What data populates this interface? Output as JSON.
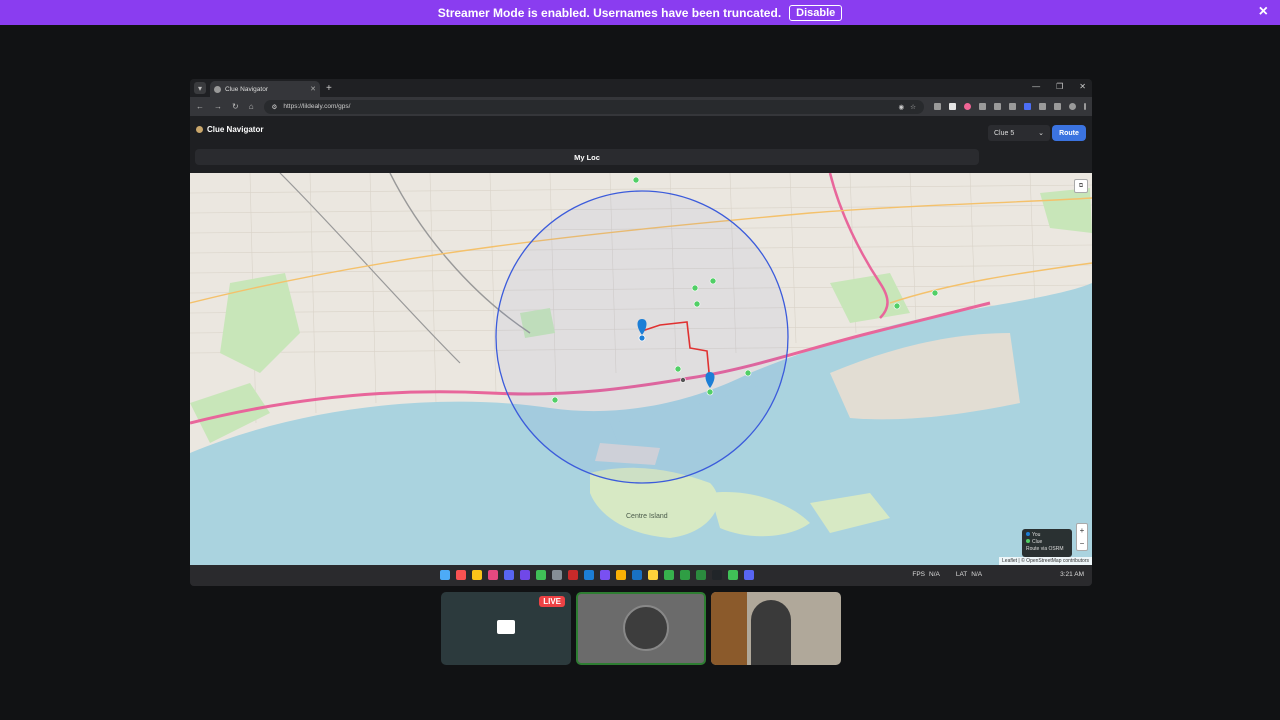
{
  "banner": {
    "message": "Streamer Mode is enabled. Usernames have been truncated.",
    "disable_label": "Disable",
    "close_icon": "×"
  },
  "browser": {
    "tab_title": "Clue Navigator",
    "url": "https://lildealy.com/gps/"
  },
  "app": {
    "title": "Clue Navigator",
    "clue_selected": "Clue 5",
    "route_label": "Route",
    "myloc_label": "My Loc"
  },
  "map": {
    "legend": {
      "you": "You",
      "clue": "Clue",
      "route": "Route via OSRM"
    },
    "attribution": "Leaflet | © OpenStreetMap contributors",
    "zoom_in": "+",
    "zoom_out": "−",
    "labels": {
      "centre_island": "Centre Island"
    },
    "colors": {
      "circle": "#3b5bdb",
      "route": "#e03131",
      "marker": "#1c7ed6",
      "clue_dot": "#51cf66",
      "water": "#aad3df"
    }
  },
  "taskbar": {
    "fps_label": "FPS",
    "fps_value": "N/A",
    "lat_label": "LAT",
    "lat_value": "N/A",
    "time": "3:21 AM"
  },
  "tiles": {
    "live_label": "LIVE"
  }
}
